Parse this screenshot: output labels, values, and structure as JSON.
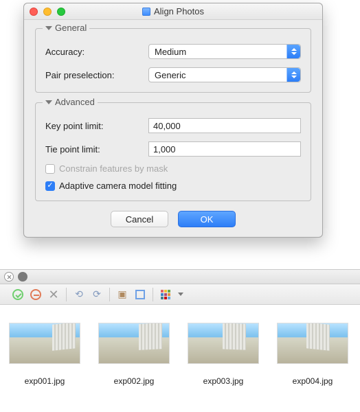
{
  "dialog": {
    "title": "Align Photos",
    "general": {
      "legend": "General",
      "accuracy_label": "Accuracy:",
      "accuracy_value": "Medium",
      "pair_label": "Pair preselection:",
      "pair_value": "Generic"
    },
    "advanced": {
      "legend": "Advanced",
      "keypoint_label": "Key point limit:",
      "keypoint_value": "40,000",
      "tiepoint_label": "Tie point limit:",
      "tiepoint_value": "1,000",
      "constrain_label": "Constrain features by mask",
      "constrain_checked": false,
      "adaptive_label": "Adaptive camera model fitting",
      "adaptive_checked": true
    },
    "buttons": {
      "cancel": "Cancel",
      "ok": "OK"
    }
  },
  "thumbnails": [
    {
      "caption": "exp001.jpg"
    },
    {
      "caption": "exp002.jpg"
    },
    {
      "caption": "exp003.jpg"
    },
    {
      "caption": "exp004.jpg"
    }
  ]
}
